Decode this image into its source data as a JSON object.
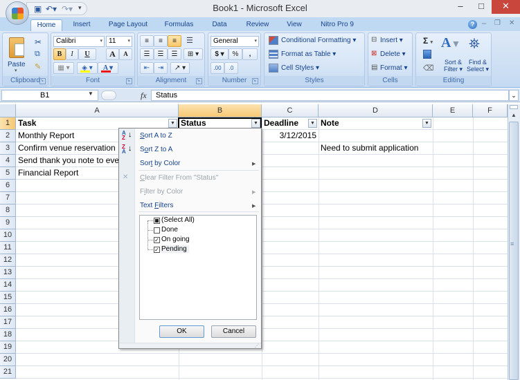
{
  "window": {
    "title": "Book1 - Microsoft Excel",
    "controls": {
      "minimize": "–",
      "maximize": "□",
      "close": "✕"
    },
    "doc_controls": {
      "help": "?",
      "minimize": "–",
      "restore": "❐",
      "close": "✕"
    }
  },
  "qat": {
    "save": "save-icon",
    "undo": "undo-icon",
    "redo": "redo-icon",
    "customize": "customize-icon"
  },
  "tabs": [
    {
      "label": "Home",
      "active": true
    },
    {
      "label": "Insert"
    },
    {
      "label": "Page Layout"
    },
    {
      "label": "Formulas"
    },
    {
      "label": "Data"
    },
    {
      "label": "Review"
    },
    {
      "label": "View"
    },
    {
      "label": "Nitro Pro 9"
    }
  ],
  "ribbon": {
    "clipboard": {
      "label": "Clipboard",
      "paste": "Paste"
    },
    "font": {
      "label": "Font",
      "font_name": "Calibri",
      "font_size": "11",
      "bold": "B",
      "italic": "I",
      "underline": "U",
      "grow": "A",
      "shrink": "A",
      "font_color_bar": "#e81416",
      "fill_color_bar": "#ffff00"
    },
    "alignment": {
      "label": "Alignment"
    },
    "number": {
      "label": "Number",
      "format": "General",
      "currency": "$",
      "percent": "%",
      "comma": ",",
      "inc_decimal": ".00",
      "dec_decimal": ".0"
    },
    "styles": {
      "label": "Styles",
      "conditional": "Conditional Formatting",
      "format_table": "Format as Table",
      "cell_styles": "Cell Styles"
    },
    "cells": {
      "label": "Cells",
      "insert": "Insert",
      "delete": "Delete",
      "format": "Format"
    },
    "editing": {
      "label": "Editing",
      "sigma": "Σ",
      "sort_filter_1": "Sort &",
      "sort_filter_2": "Filter",
      "find_1": "Find &",
      "find_2": "Select"
    }
  },
  "formula_bar": {
    "name_box": "B1",
    "fx": "fx",
    "value": "Status"
  },
  "columns": [
    "A",
    "B",
    "C",
    "D",
    "E",
    "F"
  ],
  "selected_column": "B",
  "rows": [
    "1",
    "2",
    "3",
    "4",
    "5",
    "6",
    "7",
    "8",
    "9",
    "10",
    "11",
    "12",
    "13",
    "14",
    "15",
    "16",
    "17",
    "18",
    "19",
    "20",
    "21"
  ],
  "cells": {
    "A1": "Task",
    "B1": "Status",
    "C1": "Deadline",
    "D1": "Note",
    "A2": "Monthly Report",
    "C2": "3/12/2015",
    "A3": "Confirm venue reservation",
    "D3": "Need to submit application",
    "A4": "Send thank you note to every",
    "A5": "Financial Report"
  },
  "filter_menu": {
    "sort_az": {
      "pre": "",
      "u": "S",
      "post": "ort A to Z"
    },
    "sort_za": {
      "pre": "S",
      "u": "o",
      "post": "rt Z to A"
    },
    "sort_color": {
      "pre": "Sor",
      "u": "t",
      "post": " by Color"
    },
    "clear_filter": {
      "pre": "",
      "u": "C",
      "post": "lear Filter From \"Status\""
    },
    "filter_color": {
      "pre": "F",
      "u": "i",
      "post": "lter by Color"
    },
    "text_filters": {
      "pre": "Text ",
      "u": "F",
      "post": "ilters"
    },
    "items": [
      {
        "label": "(Select All)",
        "state": "mixed"
      },
      {
        "label": "Done",
        "state": "unchecked"
      },
      {
        "label": "On going",
        "state": "checked"
      },
      {
        "label": "Pending",
        "state": "checked"
      }
    ],
    "ok": "OK",
    "cancel": "Cancel"
  }
}
